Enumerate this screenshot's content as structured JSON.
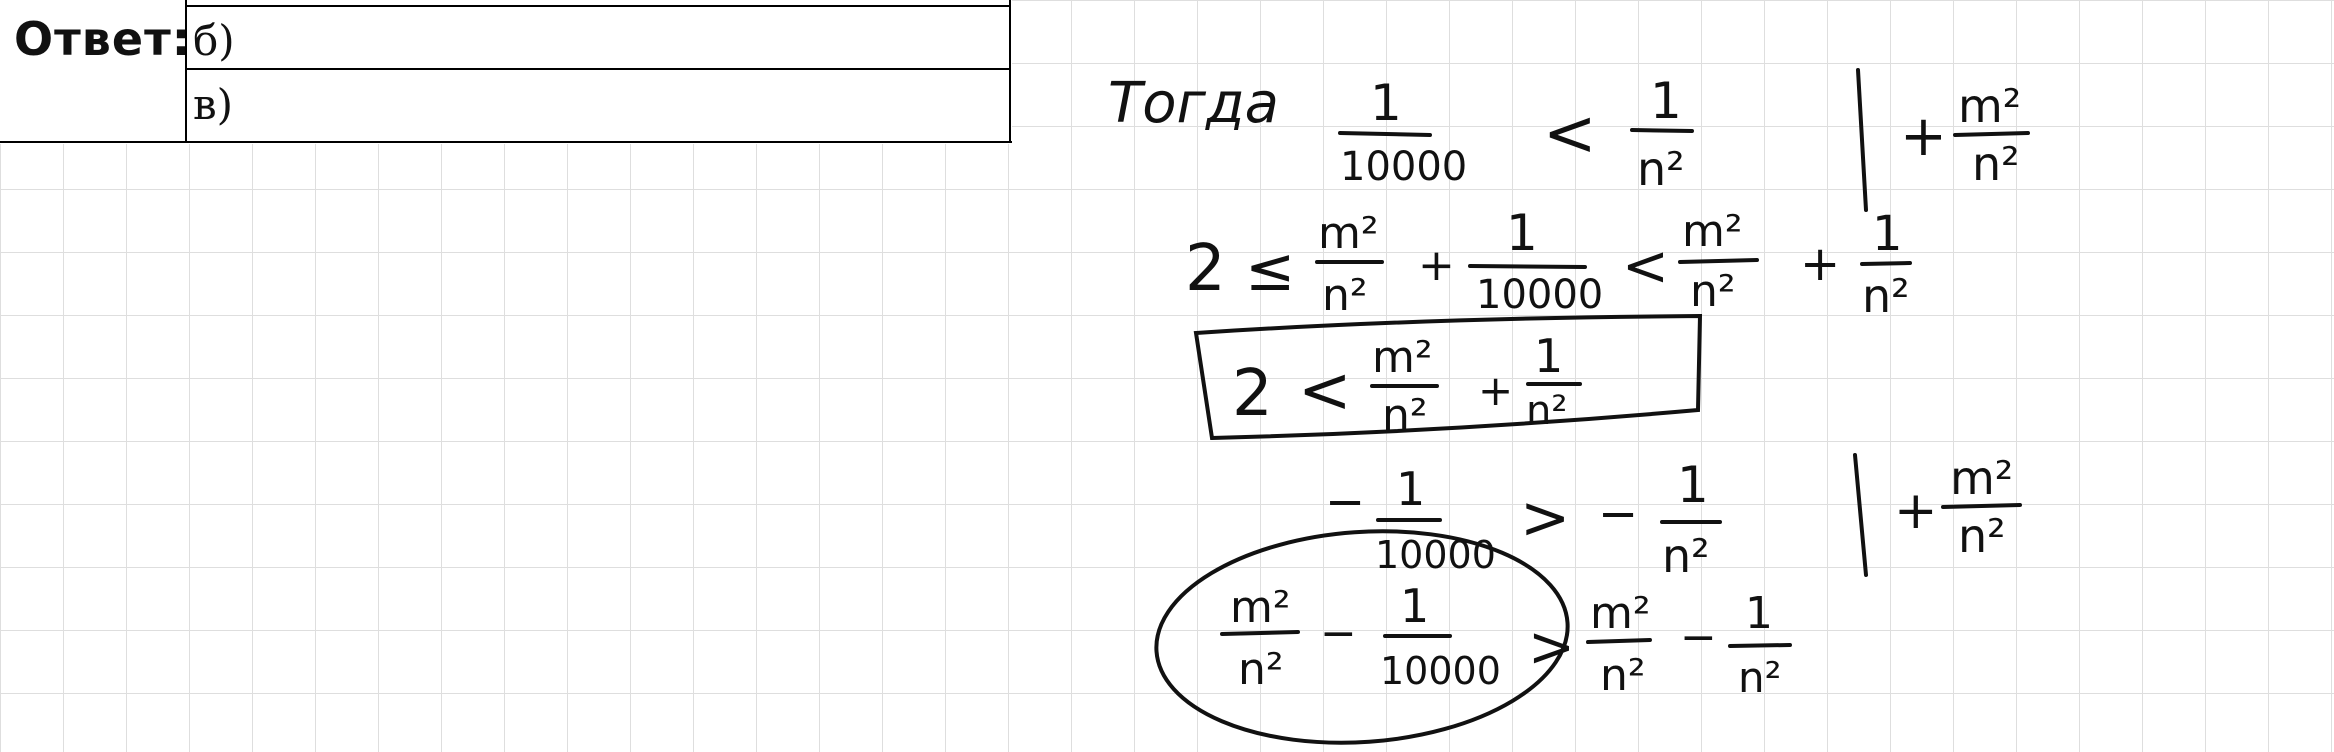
{
  "answer_table": {
    "label": "Ответ:",
    "rows": [
      "б)",
      "в)"
    ]
  },
  "notes": {
    "word_togda": "Тогда",
    "one": "1",
    "ten_thousand": "10000",
    "m2": "m²",
    "n2": "n²",
    "two": "2",
    "lt": "<",
    "le": "≤",
    "gt": ">",
    "plus": "+",
    "minus": "−"
  }
}
